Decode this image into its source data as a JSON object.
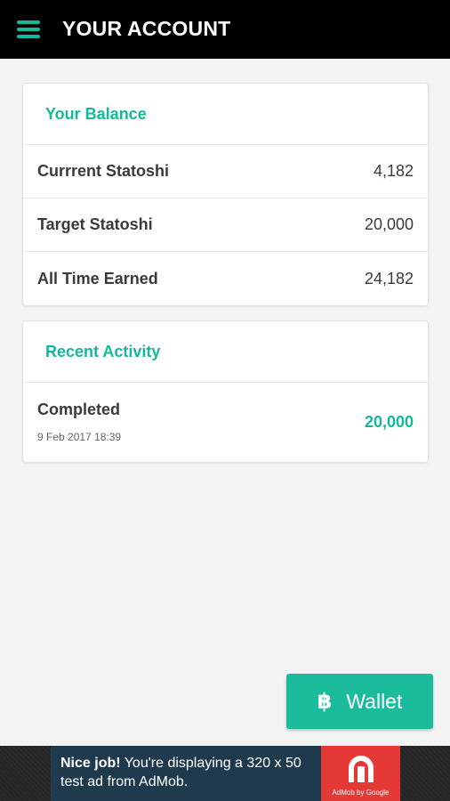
{
  "header": {
    "title": "YOUR ACCOUNT",
    "menu_icon": "hamburger-menu-icon"
  },
  "balance": {
    "heading": "Your Balance",
    "rows": [
      {
        "label": "Currrent Statoshi",
        "value": "4,182"
      },
      {
        "label": "Target Statoshi",
        "value": "20,000"
      },
      {
        "label": "All Time Earned",
        "value": "24,182"
      }
    ]
  },
  "activity": {
    "heading": "Recent Activity",
    "items": [
      {
        "status": "Completed",
        "date": "9 Feb 2017 18:39",
        "amount": "20,000"
      }
    ]
  },
  "wallet_button": {
    "icon": "฿",
    "label": "Wallet"
  },
  "ad": {
    "bold": "Nice job!",
    "text": " You're displaying a 320 x 50 test ad from AdMob.",
    "logo_caption": "AdMob by Google"
  },
  "colors": {
    "accent": "#1abc9c",
    "topbar": "#000000",
    "ad_logo": "#e53935"
  }
}
